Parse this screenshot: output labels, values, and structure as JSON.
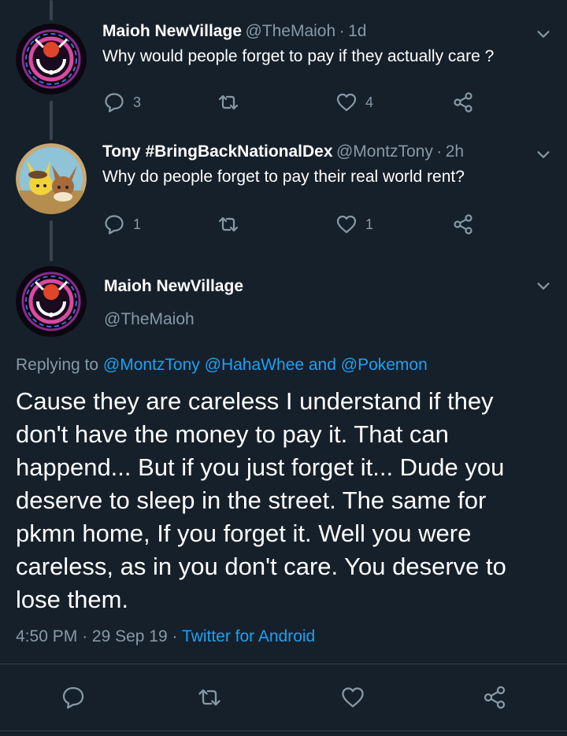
{
  "tweet1": {
    "name": "Maioh NewVillage",
    "handle": "@TheMaioh",
    "time": "1d",
    "text": "Why would people forget to pay if they actually care ?",
    "replies": "3",
    "likes": "4"
  },
  "tweet2": {
    "name": "Tony #BringBackNationalDex",
    "handle": "@MontzTony",
    "time": "2h",
    "text": "Why do people forget to pay their real world rent?",
    "replies": "1",
    "likes": "1"
  },
  "main": {
    "name": "Maioh NewVillage",
    "handle": "@TheMaioh",
    "replying_prefix": "Replying to",
    "reply_user1": "@MontzTony",
    "reply_user2": "@HahaWhee",
    "reply_and": "and",
    "reply_user3": "@Pokemon",
    "text_lines": [
      "Cause they are careless I understand if they",
      "don't have the money to pay it. That can",
      "happend... But if you just forget it... Dude you",
      "deserve to sleep in the street. The same for",
      "pkmn home, If you forget it. Well you were",
      "careless, as in you don't care. You deserve to",
      "lose them."
    ],
    "time": "4:50 PM",
    "date": "29 Sep 19",
    "source": "Twitter for Android"
  },
  "separator": "·",
  "icons": {
    "reply": "reply-icon",
    "retweet": "retweet-icon",
    "like": "heart-icon",
    "share": "share-icon",
    "chevron": "chevron-down-icon"
  },
  "colors": {
    "background": "#15202b",
    "secondary_text": "#8899a6",
    "link": "#1da1f2",
    "divider": "#38444d"
  }
}
